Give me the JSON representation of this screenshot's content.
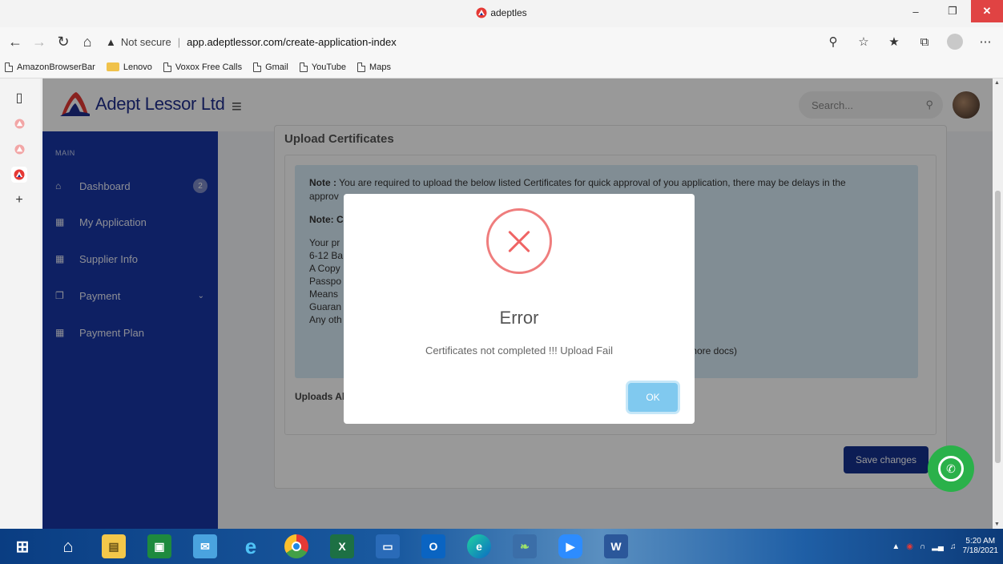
{
  "browser": {
    "window_title": "adeptles",
    "url_warning": "Not secure",
    "url": "app.adeptlessor.com/create-application-index",
    "favorites": [
      {
        "label": "AmazonBrowserBar",
        "icon": "page-icon"
      },
      {
        "label": "Lenovo",
        "icon": "folder-icon"
      },
      {
        "label": "Voxox Free Calls",
        "icon": "page-icon"
      },
      {
        "label": "Gmail",
        "icon": "page-icon"
      },
      {
        "label": "YouTube",
        "icon": "page-icon"
      },
      {
        "label": "Maps",
        "icon": "page-icon"
      }
    ]
  },
  "header": {
    "brand": "Adept Lessor Ltd",
    "search_placeholder": "Search..."
  },
  "sidebar": {
    "section": "MAIN",
    "items": [
      {
        "label": "Dashboard",
        "icon": "home-icon",
        "badge": "2"
      },
      {
        "label": "My Application",
        "icon": "calendar-icon"
      },
      {
        "label": "Supplier Info",
        "icon": "calendar-icon"
      },
      {
        "label": "Payment",
        "icon": "box-icon"
      },
      {
        "label": "Payment Plan",
        "icon": "calendar-icon"
      }
    ]
  },
  "main": {
    "card_title": "Upload Certificates",
    "note_label": "Note :",
    "note_text": "You are required to upload the below listed Certificates for quick approval of you application, there may be delays in the",
    "note_text_2": "approv",
    "note2_label": "Note: C",
    "list": [
      "Your pr",
      "6-12 Ba",
      "A Copy",
      "Passpo",
      "Means",
      "Guaran",
      "Any oth"
    ],
    "list_tail": "d more docs)",
    "uploads_label": "Uploads Al",
    "save_button": "Save changes"
  },
  "modal": {
    "title": "Error",
    "message": "Certificates not completed !!! Upload Fail",
    "ok_button": "OK"
  },
  "taskbar": {
    "time": "5:20 AM",
    "date": "7/18/2021"
  },
  "colors": {
    "sidebar": "#1836a5",
    "brand": "#1f2e8c",
    "error": "#ef7d7d",
    "ok_button": "#80c9ef",
    "save_button": "#14318e",
    "whatsapp": "#2ab14a"
  }
}
